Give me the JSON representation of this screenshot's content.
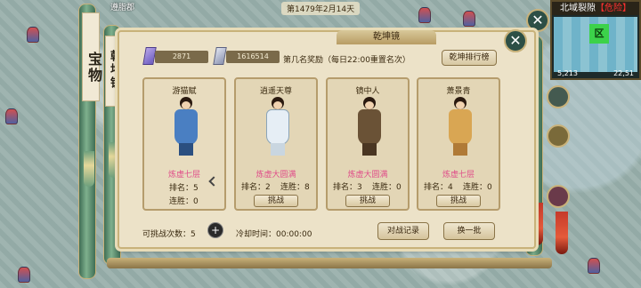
{
  "window": {
    "date": "第1479年2月14天",
    "top_name": "遵脂郡"
  },
  "minimap": {
    "title": "北域裂隙",
    "danger": "【危险】",
    "zone_label": "区",
    "coord_left": "5,213",
    "coord_right": "22,51"
  },
  "treasure_scroll": {
    "label": "宝物"
  },
  "mirror_scroll": {
    "label": "乾坤镜"
  },
  "panel": {
    "title": "乾坤镜",
    "currency1": "2871",
    "currency2": "1616514",
    "reward_text": "第几名奖励（每日22:00重置名次）",
    "rank_button": "乾坤排行榜"
  },
  "cards": [
    {
      "name": "游猫赋",
      "realm": "炼虚七层",
      "rank_label": "排名：5",
      "streak_label": "连胜：0",
      "robe_color": "#4a7fc2",
      "show_button": false
    },
    {
      "name": "逍遥天尊",
      "realm": "炼虚大圆满",
      "rank_label": "排名：2",
      "streak_label": "连胜：8",
      "robe_color": "#e6eef5",
      "show_button": true,
      "button": "挑战"
    },
    {
      "name": "镜中人",
      "realm": "炼虚大圆满",
      "rank_label": "排名：3",
      "streak_label": "连胜：0",
      "robe_color": "#6a5236",
      "show_button": true,
      "button": "挑战"
    },
    {
      "name": "萧景青",
      "realm": "炼虚七层",
      "rank_label": "排名：4",
      "streak_label": "连胜：0",
      "robe_color": "#d9a653",
      "show_button": true,
      "button": "挑战"
    }
  ],
  "footer": {
    "remaining": "可挑战次数：5",
    "add_symbol": "+",
    "cooldown": "冷却时间：00:00:00",
    "record_button": "对战记录",
    "refresh_button": "换一批"
  },
  "icons": {
    "close": "close-icon",
    "add": "plus-icon",
    "currency1": "purple-crystal-icon",
    "currency2": "silver-crystal-icon"
  }
}
